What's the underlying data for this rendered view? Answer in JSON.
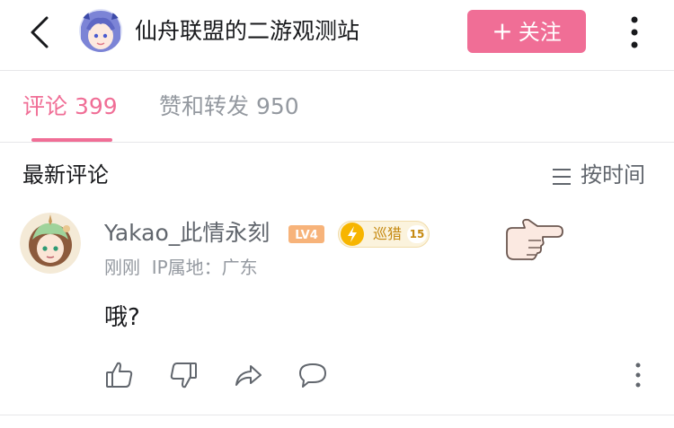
{
  "header": {
    "title": "仙舟联盟的二游观测站",
    "follow_plus": "+",
    "follow_label": "关注"
  },
  "tabs": [
    {
      "label": "评论 399",
      "active": true
    },
    {
      "label": "赞和转发 950",
      "active": false
    }
  ],
  "section": {
    "title": "最新评论",
    "sort_label": "按时间"
  },
  "comment": {
    "username": "Yakao_此情永刻",
    "level": "LV4",
    "medal_name": "巡猎",
    "medal_level": "15",
    "time": "刚刚",
    "ip_location": "IP属地：广东",
    "text": "哦?"
  },
  "colors": {
    "accent": "#f06e96",
    "text_primary": "#18191c",
    "text_secondary": "#9499a0",
    "level_badge": "#f7b37a",
    "medal": "#f7b500"
  }
}
